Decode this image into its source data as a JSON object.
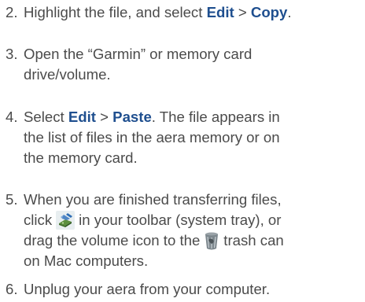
{
  "steps": [
    {
      "number": "2.",
      "text_a": "Highlight the file, and select ",
      "menu_a": "Edit",
      "sep": " > ",
      "menu_b": "Copy",
      "end": "."
    },
    {
      "number": "3.",
      "line1": "Open the “Garmin” or memory card",
      "line2": "drive/volume."
    },
    {
      "number": "4.",
      "text_a": "Select ",
      "menu_a": "Edit",
      "sep": " > ",
      "menu_b": "Paste",
      "text_b": ". The file appears in",
      "line2": "the list of files in the aera memory or on",
      "line3": "the memory card."
    },
    {
      "number": "5.",
      "line1": "When you are finished transferring files,",
      "line2_a": "click",
      "line2_b": "in your toolbar (system tray), or",
      "line3_a": "drag the volume icon to the",
      "line3_b": "trash can",
      "line4": "on Mac computers.",
      "icon_a": "safely-remove-hardware-icon",
      "icon_b": "trash-can-icon"
    },
    {
      "number": "6.",
      "line1": "Unplug your aera from your computer."
    }
  ],
  "colors": {
    "text": "#4b4b4b",
    "menu": "#1f4f8f"
  }
}
